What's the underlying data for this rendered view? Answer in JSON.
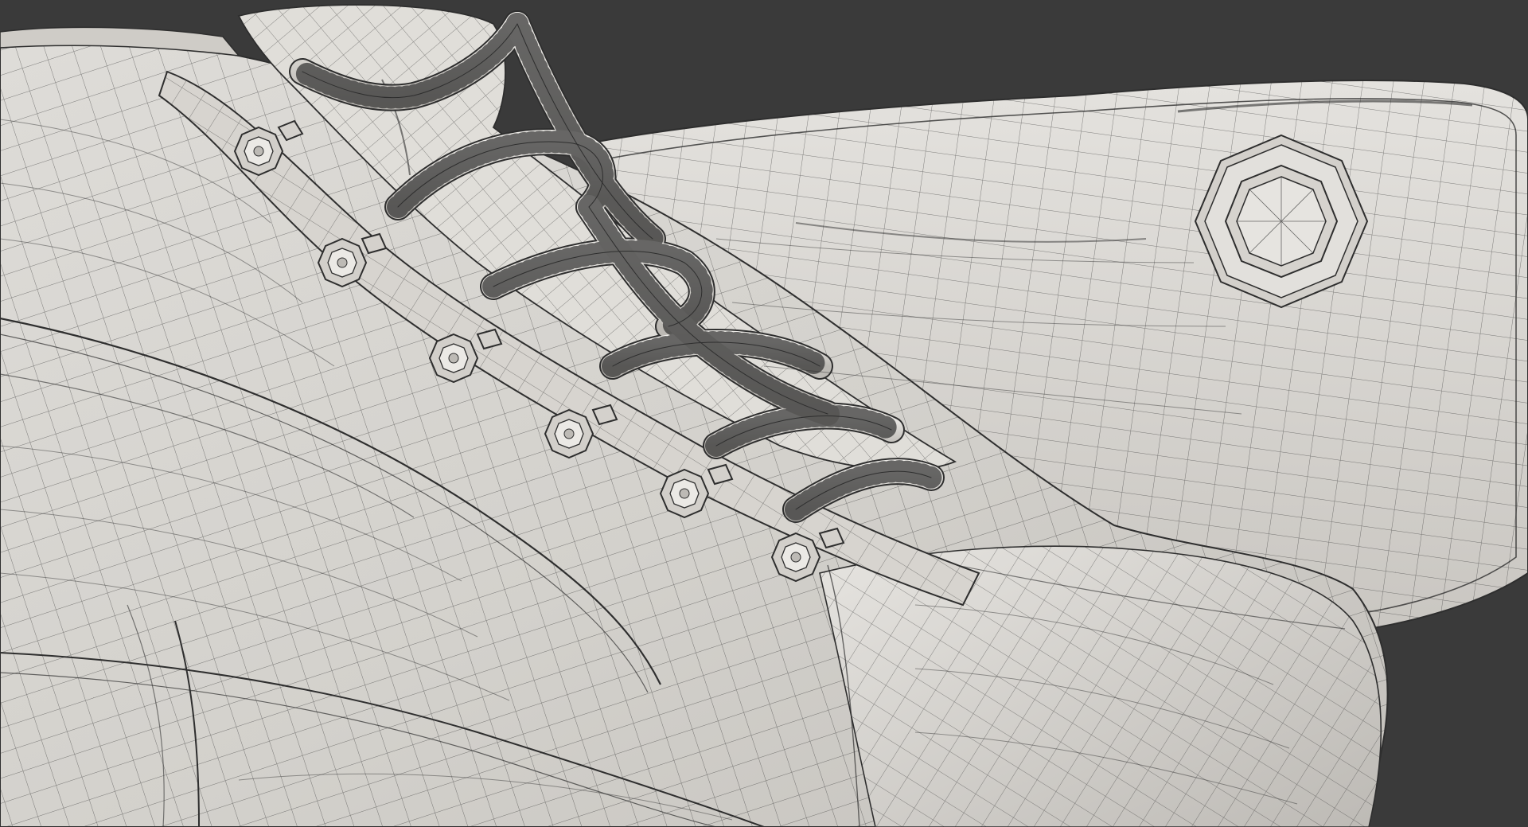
{
  "scene": {
    "subject": "wireframe-render",
    "background_color": "#3a3a3a",
    "surface_color": "#d9d7d3",
    "surface_shadow_color": "#b8b5b0",
    "wire_color": "#2e2e2e",
    "eyelet_count": 6,
    "has_sole_logo": true
  }
}
